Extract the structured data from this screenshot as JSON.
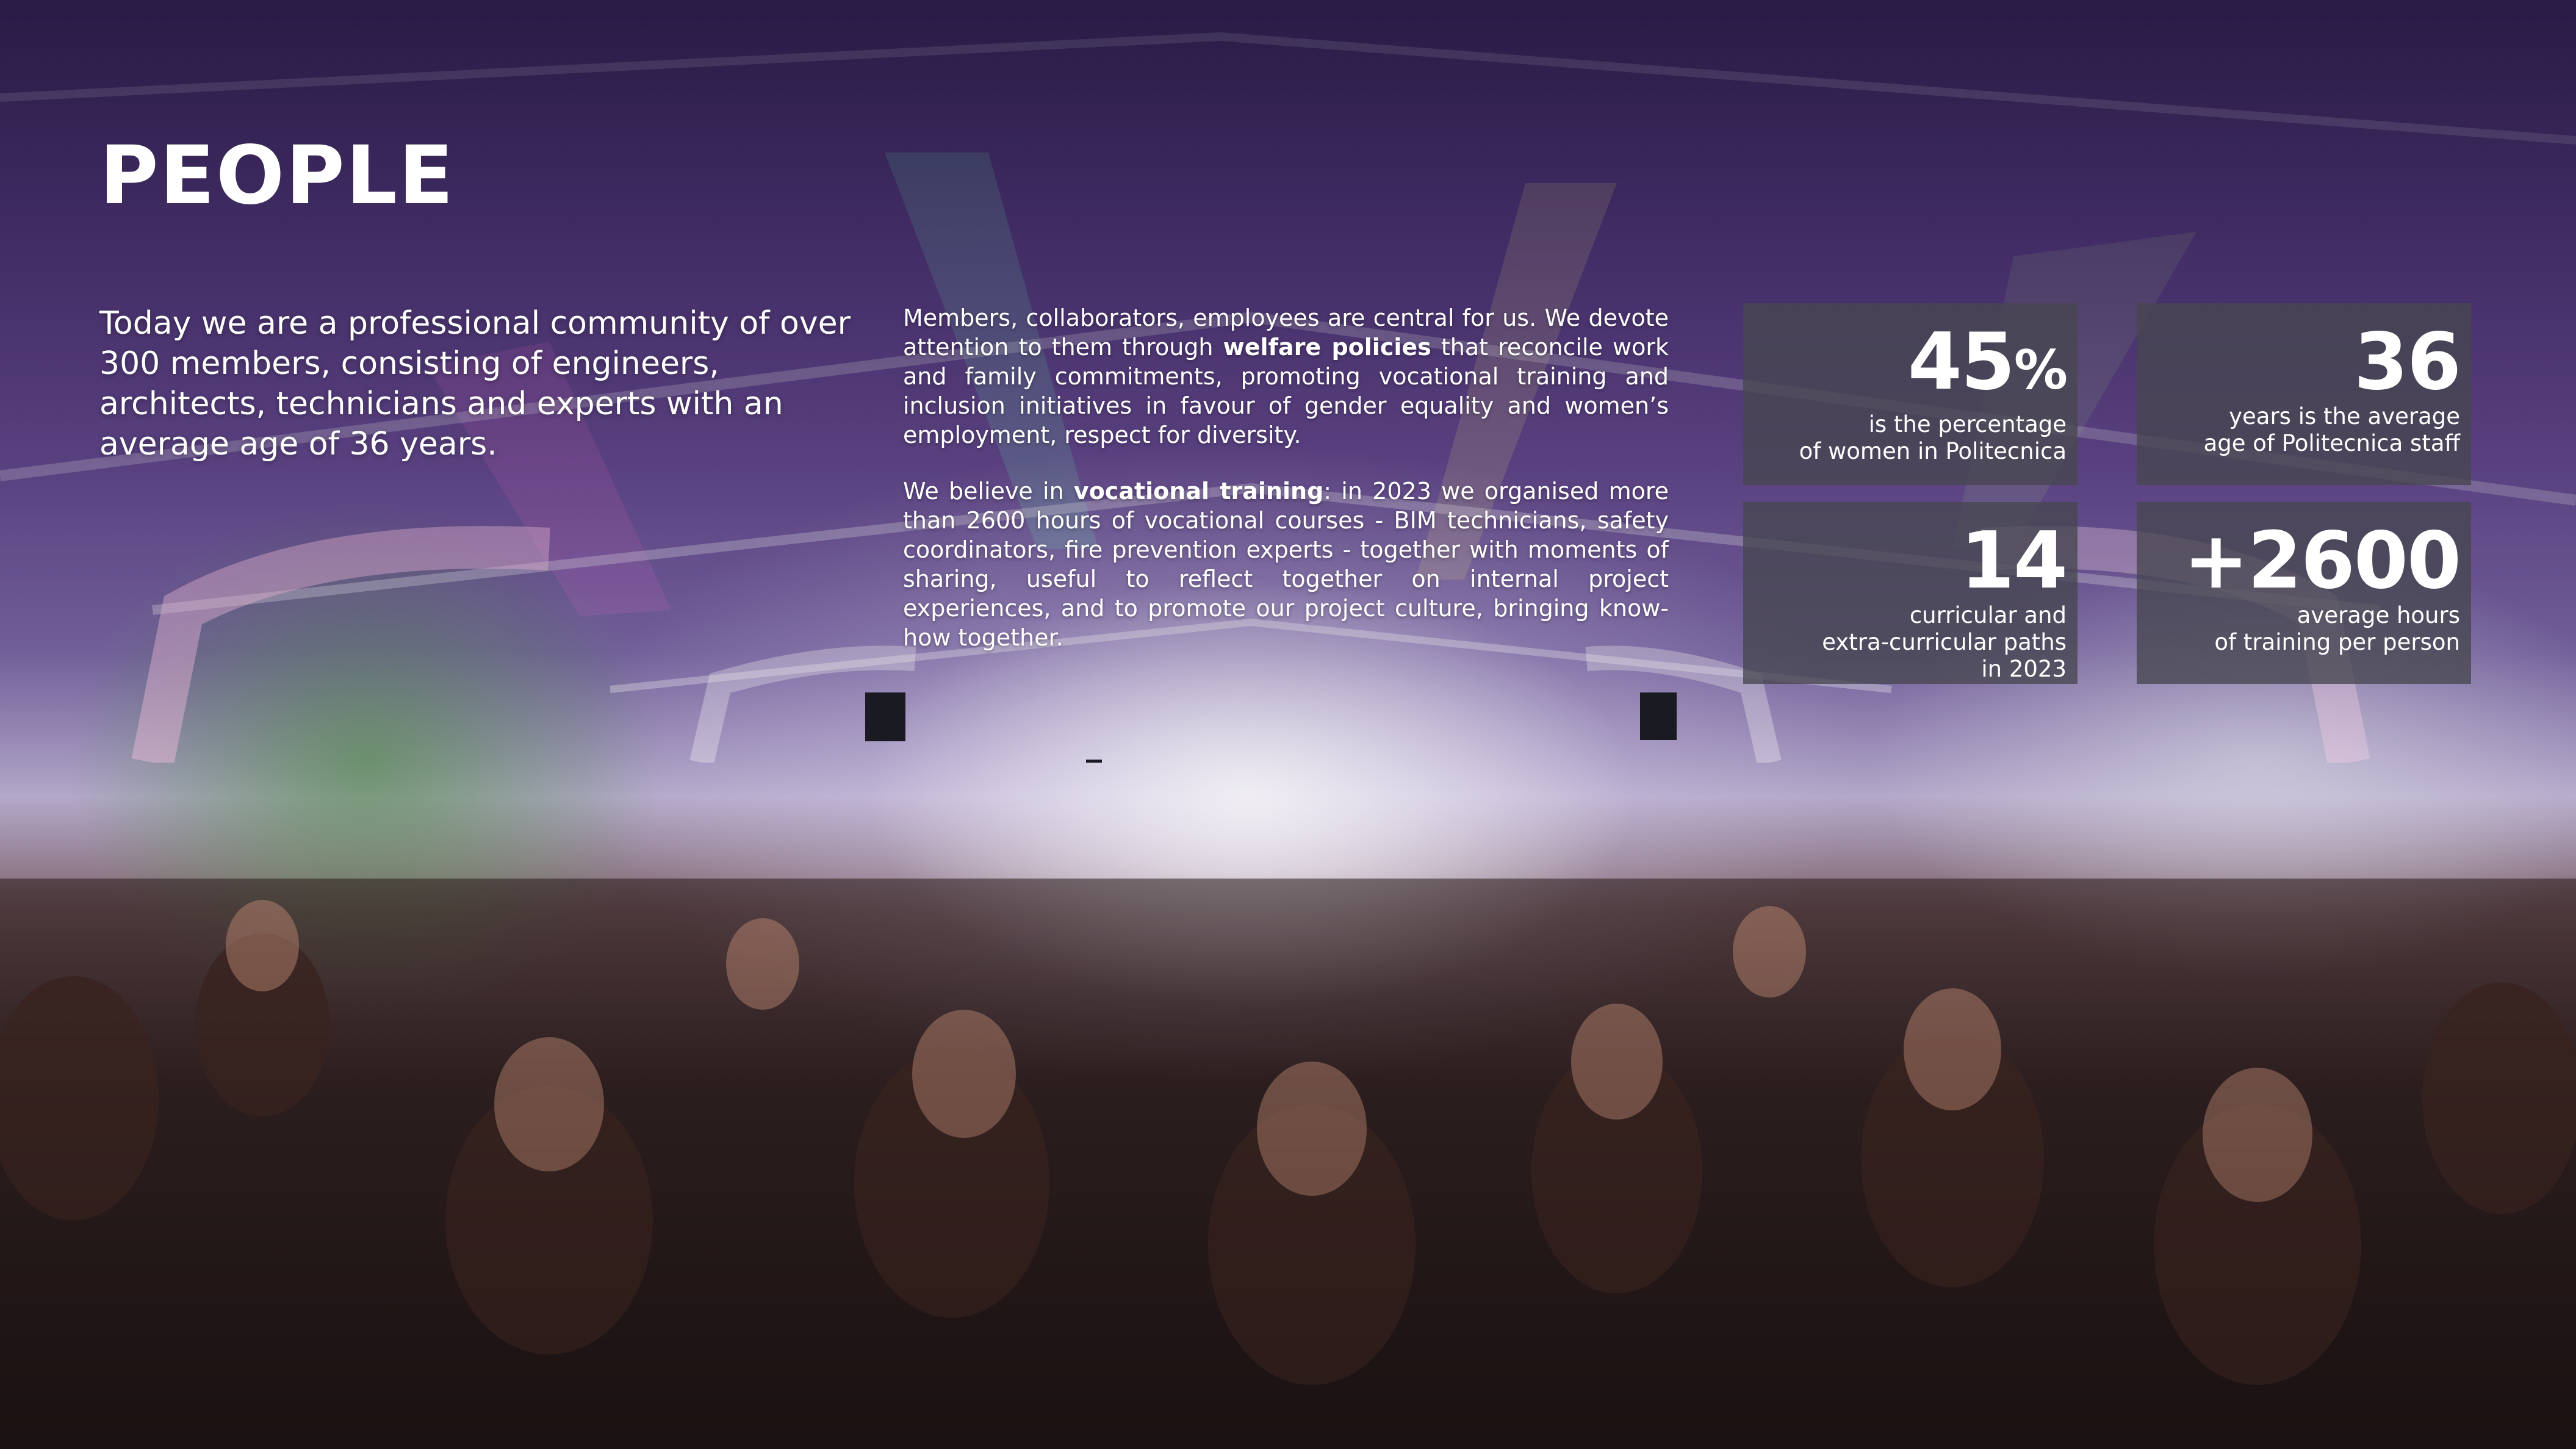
{
  "title": "PEOPLE",
  "intro": "Today we are a professional community of over 300 members, consisting of engineers, architects, technicians and experts with an average age of 36 years.",
  "paragraph1": {
    "before": "Members, collaborators, employees are central for us. We devote attention to them through ",
    "bold": "welfare policies",
    "after": " that reconcile work and family commitments, promoting vocational training and inclusion initiatives in favour of gender equality and women’s employment, respect for diversity."
  },
  "paragraph2": {
    "before": "We believe in ",
    "bold": "vocational training",
    "after": ": in 2023 we organised more than 2600 hours of vocational courses - BIM technicians, safety coordinators, fire prevention experts - together with moments of sharing, useful to reflect together on internal project experiences, and to promote our project culture, bringing know-how together."
  },
  "stats": {
    "women": {
      "value": "45",
      "unit": "%",
      "caption_line1": "is the percentage",
      "caption_line2": "of women in Politecnica"
    },
    "age": {
      "value": "36",
      "caption_line1": "years is the average",
      "caption_line2": "age of Politecnica staff"
    },
    "paths": {
      "value": "14",
      "caption_line1": "curricular and",
      "caption_line2": "extra-curricular paths",
      "caption_line3": "in 2023"
    },
    "hours": {
      "value": "+2600",
      "caption_line1": "average hours",
      "caption_line2": "of training per person"
    }
  }
}
